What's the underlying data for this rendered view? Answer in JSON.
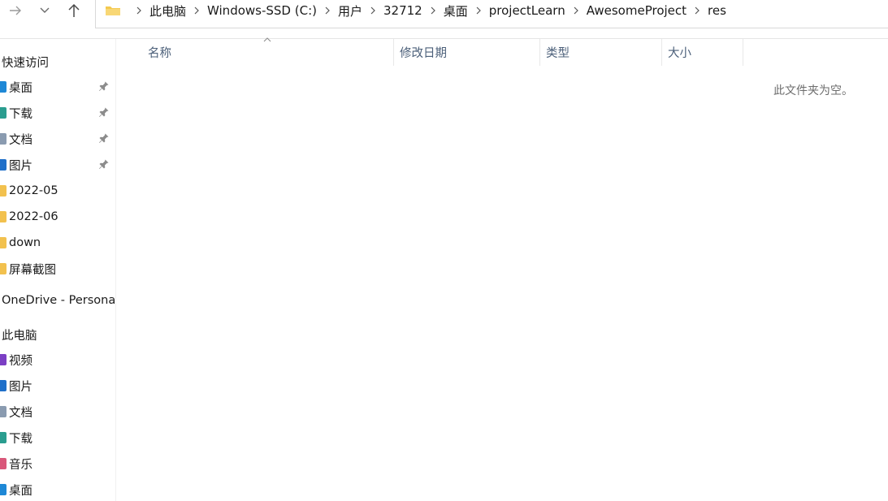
{
  "breadcrumbs": [
    "此电脑",
    "Windows-SSD (C:)",
    "用户",
    "32712",
    "桌面",
    "projectLearn",
    "AwesomeProject",
    "res"
  ],
  "sidebar": {
    "quick_access": {
      "header": "快速访问",
      "items": [
        {
          "label": "桌面",
          "icon": "desktop-icon",
          "color": "#1e88d6",
          "pinned": true
        },
        {
          "label": "下载",
          "icon": "download-icon",
          "color": "#2a9d8f",
          "pinned": true
        },
        {
          "label": "文档",
          "icon": "document-icon",
          "color": "#8a9bb0",
          "pinned": true
        },
        {
          "label": "图片",
          "icon": "pictures-icon",
          "color": "#1f6fc9",
          "pinned": true
        },
        {
          "label": "2022-05",
          "icon": "folder-icon",
          "color": "#f2c14e",
          "pinned": false
        },
        {
          "label": "2022-06",
          "icon": "folder-icon",
          "color": "#f2c14e",
          "pinned": false
        },
        {
          "label": "down",
          "icon": "folder-icon",
          "color": "#f2c14e",
          "pinned": false
        },
        {
          "label": "屏幕截图",
          "icon": "folder-icon",
          "color": "#f2c14e",
          "pinned": false
        }
      ]
    },
    "onedrive": {
      "label": "OneDrive - Persona"
    },
    "this_pc": {
      "header": "此电脑",
      "items": [
        {
          "label": "视频",
          "icon": "video-icon",
          "color": "#7b3fc4"
        },
        {
          "label": "图片",
          "icon": "pictures-icon",
          "color": "#1f6fc9"
        },
        {
          "label": "文档",
          "icon": "document-icon",
          "color": "#8a9bb0"
        },
        {
          "label": "下载",
          "icon": "download-icon",
          "color": "#2a9d8f"
        },
        {
          "label": "音乐",
          "icon": "music-icon",
          "color": "#d9577a"
        },
        {
          "label": "桌面",
          "icon": "desktop-icon",
          "color": "#1e88d6"
        }
      ]
    }
  },
  "columns": [
    "名称",
    "修改日期",
    "类型",
    "大小"
  ],
  "empty_message": "此文件夹为空。"
}
